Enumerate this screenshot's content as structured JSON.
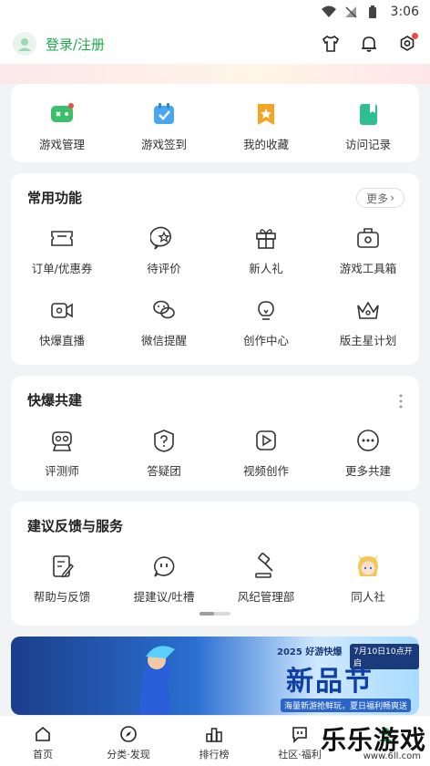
{
  "status_bar": {
    "time": "3:06"
  },
  "header": {
    "login_label": "登录/注册"
  },
  "quick_actions": [
    {
      "label": "游戏管理",
      "icon": "gamepad-icon",
      "color": "#3bbf6a",
      "badge": true
    },
    {
      "label": "游戏签到",
      "icon": "calendar-check-icon",
      "color": "#4aa7ef",
      "badge": false
    },
    {
      "label": "我的收藏",
      "icon": "star-bookmark-icon",
      "color": "#f5a524",
      "badge": false
    },
    {
      "label": "访问记录",
      "icon": "book-icon",
      "color": "#2fbf8f",
      "badge": false
    }
  ],
  "common_functions": {
    "title": "常用功能",
    "more_label": "更多",
    "items": [
      {
        "label": "订单/优惠券",
        "icon": "coupon-icon"
      },
      {
        "label": "待评价",
        "icon": "rating-icon"
      },
      {
        "label": "新人礼",
        "icon": "gift-icon"
      },
      {
        "label": "游戏工具箱",
        "icon": "toolbox-icon"
      },
      {
        "label": "快爆直播",
        "icon": "live-camera-icon"
      },
      {
        "label": "微信提醒",
        "icon": "wechat-icon"
      },
      {
        "label": "创作中心",
        "icon": "bulb-icon"
      },
      {
        "label": "版主星计划",
        "icon": "crown-icon"
      }
    ]
  },
  "co_build": {
    "title": "快爆共建",
    "items": [
      {
        "label": "评测师",
        "icon": "reviewer-icon"
      },
      {
        "label": "答疑团",
        "icon": "question-icon"
      },
      {
        "label": "视频创作",
        "icon": "video-play-icon"
      },
      {
        "label": "更多共建",
        "icon": "more-dots-icon"
      }
    ]
  },
  "feedback": {
    "title": "建议反馈与服务",
    "items": [
      {
        "label": "帮助与反馈",
        "icon": "help-edit-icon"
      },
      {
        "label": "提建议/吐槽",
        "icon": "suggest-chat-icon"
      },
      {
        "label": "风纪管理部",
        "icon": "gavel-icon"
      },
      {
        "label": "同人社",
        "icon": "anime-avatar-icon"
      }
    ]
  },
  "promo_banner": {
    "tag": "2025 好游快爆",
    "date": "7月10日10点开启",
    "headline": "新品节",
    "subline": "海量新游抢鲜玩，夏日福利畅爽送"
  },
  "bottom_nav": [
    {
      "label": "首页",
      "icon": "home-icon"
    },
    {
      "label": "分类·发现",
      "icon": "compass-icon"
    },
    {
      "label": "排行榜",
      "icon": "ranking-icon"
    },
    {
      "label": "社区·福利",
      "icon": "community-icon"
    },
    {
      "label": "",
      "icon": "profile-icon"
    }
  ],
  "watermark": {
    "text": "乐乐游戏",
    "url": "www.6ll.com"
  },
  "colors": {
    "accent": "#1fa84f",
    "badge": "#f04a43",
    "background": "#f2f3f5"
  }
}
